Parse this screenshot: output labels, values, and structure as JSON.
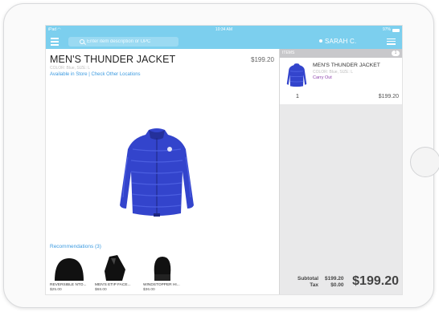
{
  "status": {
    "carrier": "iPad",
    "time": "10:34 AM",
    "battery": "97%"
  },
  "nav": {
    "search_placeholder": "Enter item description or UPC",
    "user": "SARAH C."
  },
  "product": {
    "title": "MEN'S THUNDER JACKET",
    "price": "$199.20",
    "attributes": "COLOR: Blue, SIZE: L",
    "link_available": "Available in Store",
    "link_separator": "|",
    "link_other": "Check Other Locations"
  },
  "recommendations": {
    "title": "Recommendations (3)",
    "items": [
      {
        "name": "REVERSIBLE NTO...",
        "price": "$25.00"
      },
      {
        "name": "MEN'S ETIP FACE...",
        "price": "$68.00"
      },
      {
        "name": "WINDSTOPPER HI...",
        "price": "$36.00"
      }
    ]
  },
  "cart": {
    "header": "ITEMS",
    "count": "1",
    "item": {
      "name": "MEN'S THUNDER JACKET",
      "attributes": "COLOR: Blue, SIZE: L",
      "fulfillment": "Carry Out",
      "quantity": "1",
      "price": "$199.20"
    },
    "totals": {
      "subtotal_label": "Subtotal",
      "subtotal": "$199.20",
      "tax_label": "Tax",
      "tax": "$0.00",
      "total": "$199.20"
    }
  },
  "colors": {
    "accent": "#7ccfee",
    "link": "#3d9be0",
    "carry_out": "#8e44ad",
    "jacket": "#3344cc"
  }
}
